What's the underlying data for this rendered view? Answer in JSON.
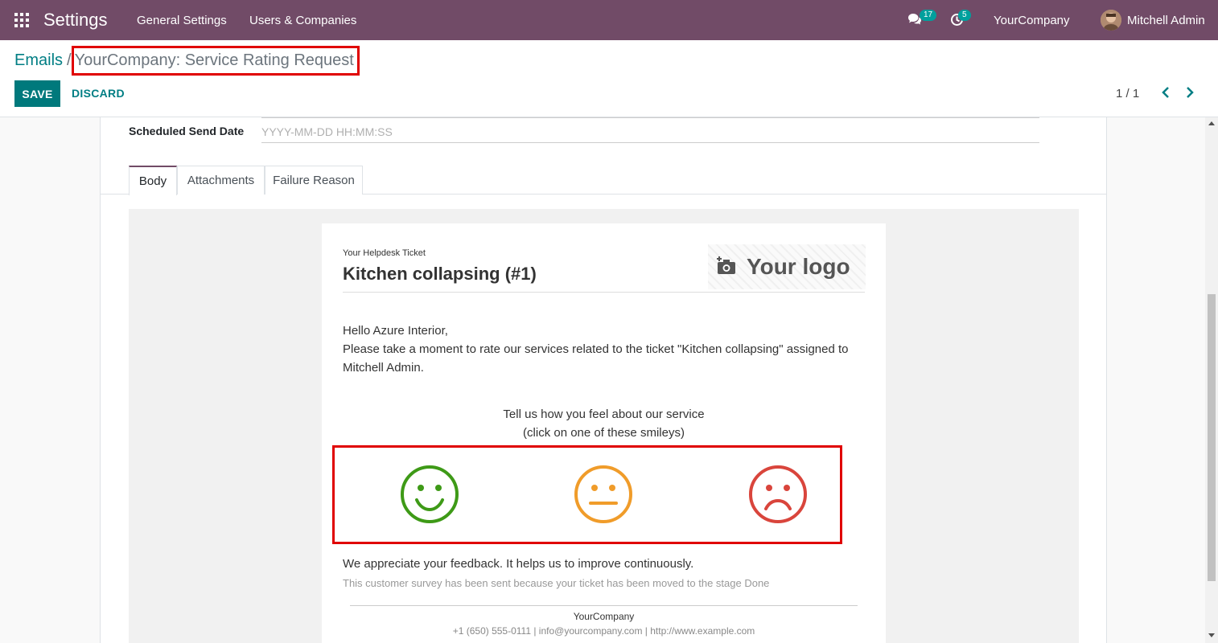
{
  "navbar": {
    "app_title": "Settings",
    "menu": [
      "General Settings",
      "Users & Companies"
    ],
    "messages_count": "17",
    "activities_count": "5",
    "company": "YourCompany",
    "user": "Mitchell Admin",
    "color": "#714b67"
  },
  "control_panel": {
    "breadcrumb_parent": "Emails",
    "breadcrumb_separator": "/",
    "breadcrumb_current": "YourCompany: Service Rating Request",
    "save_label": "SAVE",
    "discard_label": "DISCARD",
    "pager": "1 / 1"
  },
  "form": {
    "scheduled_label": "Scheduled Send Date",
    "scheduled_placeholder": "YYYY-MM-DD HH:MM:SS",
    "tabs": [
      "Body",
      "Attachments",
      "Failure Reason"
    ],
    "active_tab": "Body"
  },
  "email": {
    "ticket_label": "Your Helpdesk Ticket",
    "ticket_title": "Kitchen collapsing (#1)",
    "logo_text": "Your logo",
    "greeting": "Hello Azure Interior,",
    "message": "Please take a moment to rate our services related to the ticket \"Kitchen collapsing\" assigned to Mitchell Admin.",
    "prompt_line1": "Tell us how you feel about our service",
    "prompt_line2": "(click on one of these smileys)",
    "smileys": [
      {
        "icon": "smiley-happy-icon",
        "color": "#3e9a17"
      },
      {
        "icon": "smiley-neutral-icon",
        "color": "#f09c2a"
      },
      {
        "icon": "smiley-sad-icon",
        "color": "#d9453c"
      }
    ],
    "appreciate": "We appreciate your feedback. It helps us to improve continuously.",
    "survey_note": "This customer survey has been sent because your ticket has been moved to the stage Done",
    "footer_company": "YourCompany",
    "footer_contact": "+1 (650) 555-0111 | info@yourcompany.com | http://www.example.com"
  }
}
